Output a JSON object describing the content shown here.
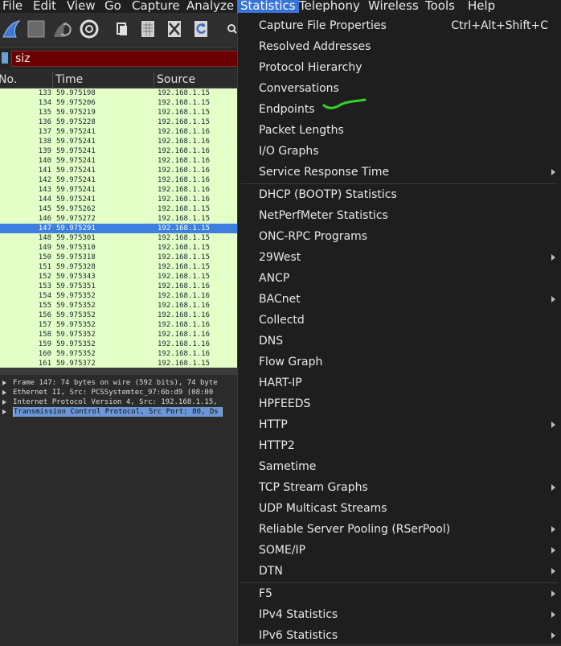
{
  "menubar": {
    "file": "File",
    "edit": "Edit",
    "view": "View",
    "go": "Go",
    "capture": "Capture",
    "analyze": "Analyze",
    "statistics": "Statistics",
    "telephony": "Telephony",
    "wireless": "Wireless",
    "tools": "Tools",
    "help": "Help"
  },
  "filter": {
    "value": "siz"
  },
  "packet_list": {
    "columns": {
      "no": "No.",
      "time": "Time",
      "source": "Source"
    },
    "selected_index": 14,
    "rows": [
      {
        "no": "133",
        "time": "59.975198",
        "src": "192.168.1.15"
      },
      {
        "no": "134",
        "time": "59.975206",
        "src": "192.168.1.15"
      },
      {
        "no": "135",
        "time": "59.975219",
        "src": "192.168.1.15"
      },
      {
        "no": "136",
        "time": "59.975228",
        "src": "192.168.1.15"
      },
      {
        "no": "137",
        "time": "59.975241",
        "src": "192.168.1.16"
      },
      {
        "no": "138",
        "time": "59.975241",
        "src": "192.168.1.16"
      },
      {
        "no": "139",
        "time": "59.975241",
        "src": "192.168.1.16"
      },
      {
        "no": "140",
        "time": "59.975241",
        "src": "192.168.1.16"
      },
      {
        "no": "141",
        "time": "59.975241",
        "src": "192.168.1.16"
      },
      {
        "no": "142",
        "time": "59.975241",
        "src": "192.168.1.16"
      },
      {
        "no": "143",
        "time": "59.975241",
        "src": "192.168.1.16"
      },
      {
        "no": "144",
        "time": "59.975241",
        "src": "192.168.1.16"
      },
      {
        "no": "145",
        "time": "59.975262",
        "src": "192.168.1.15"
      },
      {
        "no": "146",
        "time": "59.975272",
        "src": "192.168.1.15"
      },
      {
        "no": "147",
        "time": "59.975291",
        "src": "192.168.1.15"
      },
      {
        "no": "148",
        "time": "59.975301",
        "src": "192.168.1.15"
      },
      {
        "no": "149",
        "time": "59.975310",
        "src": "192.168.1.15"
      },
      {
        "no": "150",
        "time": "59.975318",
        "src": "192.168.1.15"
      },
      {
        "no": "151",
        "time": "59.975328",
        "src": "192.168.1.15"
      },
      {
        "no": "152",
        "time": "59.975343",
        "src": "192.168.1.15"
      },
      {
        "no": "153",
        "time": "59.975351",
        "src": "192.168.1.16"
      },
      {
        "no": "154",
        "time": "59.975352",
        "src": "192.168.1.16"
      },
      {
        "no": "155",
        "time": "59.975352",
        "src": "192.168.1.16"
      },
      {
        "no": "156",
        "time": "59.975352",
        "src": "192.168.1.16"
      },
      {
        "no": "157",
        "time": "59.975352",
        "src": "192.168.1.16"
      },
      {
        "no": "158",
        "time": "59.975352",
        "src": "192.168.1.16"
      },
      {
        "no": "159",
        "time": "59.975352",
        "src": "192.168.1.16"
      },
      {
        "no": "160",
        "time": "59.975352",
        "src": "192.168.1.16"
      },
      {
        "no": "161",
        "time": "59.975372",
        "src": "192.168.1.15"
      }
    ]
  },
  "details": {
    "rows": [
      "Frame 147: 74 bytes on wire (592 bits), 74 byte",
      "Ethernet II, Src: PCSSystemtec_97:6b:d9 (08:00",
      "Internet Protocol Version 4, Src: 192.168.1.15,",
      "Transmission Control Protocol, Src Port: 80, Ds"
    ],
    "selected_index": 3
  },
  "statistics_menu": {
    "items": [
      {
        "label": "Capture File Properties",
        "shortcut": "Ctrl+Alt+Shift+C"
      },
      {
        "label": "Resolved Addresses"
      },
      {
        "label": "Protocol Hierarchy"
      },
      {
        "label": "Conversations"
      },
      {
        "label": "Endpoints"
      },
      {
        "label": "Packet Lengths"
      },
      {
        "label": "I/O Graphs"
      },
      {
        "label": "Service Response Time",
        "submenu": true
      },
      {
        "label": "DHCP (BOOTP) Statistics"
      },
      {
        "label": "NetPerfMeter Statistics"
      },
      {
        "label": "ONC-RPC Programs"
      },
      {
        "label": "29West",
        "submenu": true
      },
      {
        "label": "ANCP"
      },
      {
        "label": "BACnet",
        "submenu": true
      },
      {
        "label": "Collectd"
      },
      {
        "label": "DNS"
      },
      {
        "label": "Flow Graph"
      },
      {
        "label": "HART-IP"
      },
      {
        "label": "HPFEEDS"
      },
      {
        "label": "HTTP",
        "submenu": true
      },
      {
        "label": "HTTP2"
      },
      {
        "label": "Sametime"
      },
      {
        "label": "TCP Stream Graphs",
        "submenu": true
      },
      {
        "label": "UDP Multicast Streams"
      },
      {
        "label": "Reliable Server Pooling (RSerPool)",
        "submenu": true
      },
      {
        "label": "SOME/IP",
        "submenu": true
      },
      {
        "label": "DTN",
        "submenu": true
      },
      {
        "label": "F5",
        "submenu": true
      },
      {
        "label": "IPv4 Statistics",
        "submenu": true
      },
      {
        "label": "IPv6 Statistics",
        "submenu": true
      }
    ]
  },
  "icons": {
    "toolbar": [
      "shark-fin-icon",
      "stop-icon",
      "restart-icon",
      "capture-options-icon",
      "open-file-icon",
      "file-save-icon",
      "close-file-icon",
      "reload-icon",
      "search-icon"
    ],
    "annotation": "green-underline-mark"
  },
  "colors": {
    "menu_active": "#3874d8",
    "packet_row_bg": "#e4ffc7",
    "packet_selected": "#3d7ee0",
    "filter_bg": "#6b0000",
    "annotation": "#31d42a"
  }
}
